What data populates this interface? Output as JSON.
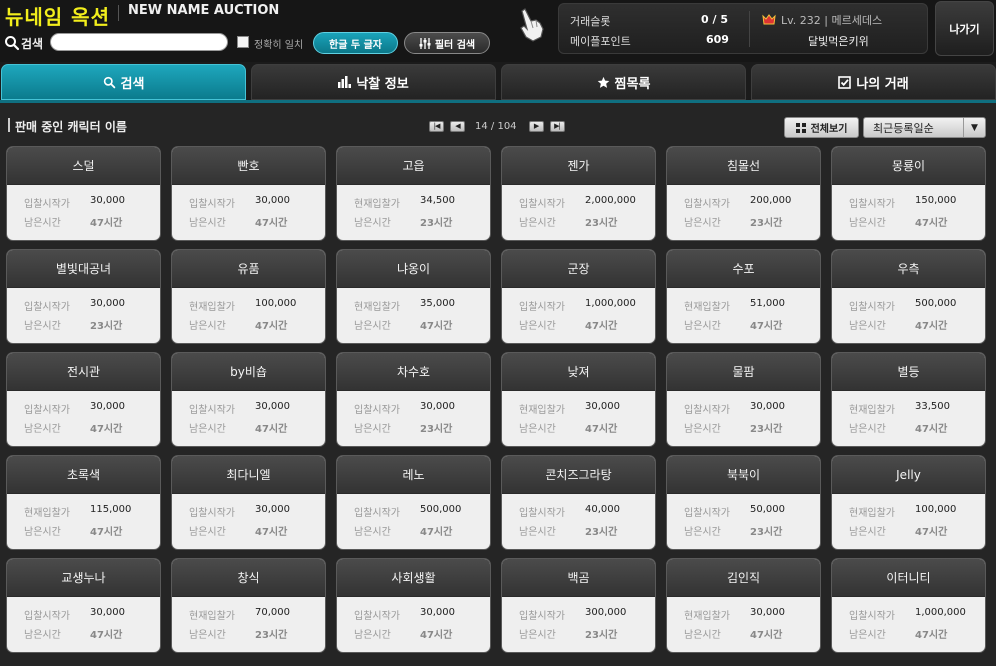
{
  "header": {
    "title_ko": "뉴네임 옥션",
    "title_en": "NEW NAME AUCTION",
    "search_label": "검색",
    "search_value": "",
    "exact_match_label": "정확히 일치",
    "two_letter_button": "한글 두 글자",
    "filter_button": "필터 검색",
    "exit_button": "나가기"
  },
  "info": {
    "slot_label": "거래슬롯",
    "slot_value": "0 / 5",
    "points_label": "메이플포인트",
    "points_value": "609",
    "level_text": "Lv. 232 | 메르세데스",
    "character_name": "달빛먹은키위"
  },
  "tabs": [
    {
      "label": "검색",
      "icon": "search-icon",
      "active": true
    },
    {
      "label": "낙찰 정보",
      "icon": "bar-chart-icon",
      "active": false
    },
    {
      "label": "찜목록",
      "icon": "star-icon",
      "active": false
    },
    {
      "label": "나의 거래",
      "icon": "checkbox-icon",
      "active": false
    }
  ],
  "list": {
    "title": "판매 중인 캐릭터 이름",
    "page_text": "14 / 104",
    "view_all_label": "전체보기",
    "sort_value": "최근등록일순"
  },
  "colors": {
    "accent": "#1597ad",
    "title_yellow": "#f2ee1c"
  },
  "cards": [
    {
      "name": "스덜",
      "price_label": "입찰시작가",
      "price": "30,000",
      "time_label": "남은시간",
      "time": "47시간"
    },
    {
      "name": "빤호",
      "price_label": "입찰시작가",
      "price": "30,000",
      "time_label": "남은시간",
      "time": "47시간"
    },
    {
      "name": "고읍",
      "price_label": "현재입찰가",
      "price": "34,500",
      "time_label": "남은시간",
      "time": "23시간"
    },
    {
      "name": "젠가",
      "price_label": "입찰시작가",
      "price": "2,000,000",
      "time_label": "남은시간",
      "time": "23시간"
    },
    {
      "name": "침몰선",
      "price_label": "입찰시작가",
      "price": "200,000",
      "time_label": "남은시간",
      "time": "23시간"
    },
    {
      "name": "몽룡이",
      "price_label": "입찰시작가",
      "price": "150,000",
      "time_label": "남은시간",
      "time": "47시간"
    },
    {
      "name": "별빛대공녀",
      "price_label": "입찰시작가",
      "price": "30,000",
      "time_label": "남은시간",
      "time": "23시간"
    },
    {
      "name": "유품",
      "price_label": "현재입찰가",
      "price": "100,000",
      "time_label": "남은시간",
      "time": "47시간"
    },
    {
      "name": "냐옹이",
      "price_label": "현재입찰가",
      "price": "35,000",
      "time_label": "남은시간",
      "time": "47시간"
    },
    {
      "name": "군장",
      "price_label": "입찰시작가",
      "price": "1,000,000",
      "time_label": "남은시간",
      "time": "47시간"
    },
    {
      "name": "수포",
      "price_label": "현재입찰가",
      "price": "51,000",
      "time_label": "남은시간",
      "time": "47시간"
    },
    {
      "name": "우측",
      "price_label": "입찰시작가",
      "price": "500,000",
      "time_label": "남은시간",
      "time": "47시간"
    },
    {
      "name": "전시관",
      "price_label": "입찰시작가",
      "price": "30,000",
      "time_label": "남은시간",
      "time": "47시간"
    },
    {
      "name": "by비숍",
      "price_label": "입찰시작가",
      "price": "30,000",
      "time_label": "남은시간",
      "time": "47시간"
    },
    {
      "name": "차수호",
      "price_label": "입찰시작가",
      "price": "30,000",
      "time_label": "남은시간",
      "time": "23시간"
    },
    {
      "name": "낮져",
      "price_label": "현재입찰가",
      "price": "30,000",
      "time_label": "남은시간",
      "time": "47시간"
    },
    {
      "name": "물팜",
      "price_label": "입찰시작가",
      "price": "30,000",
      "time_label": "남은시간",
      "time": "23시간"
    },
    {
      "name": "별등",
      "price_label": "현재입찰가",
      "price": "33,500",
      "time_label": "남은시간",
      "time": "47시간"
    },
    {
      "name": "초록색",
      "price_label": "현재입찰가",
      "price": "115,000",
      "time_label": "남은시간",
      "time": "47시간"
    },
    {
      "name": "최다니엘",
      "price_label": "입찰시작가",
      "price": "30,000",
      "time_label": "남은시간",
      "time": "47시간"
    },
    {
      "name": "레노",
      "price_label": "입찰시작가",
      "price": "500,000",
      "time_label": "남은시간",
      "time": "47시간"
    },
    {
      "name": "콘치즈그라탕",
      "price_label": "입찰시작가",
      "price": "40,000",
      "time_label": "남은시간",
      "time": "23시간"
    },
    {
      "name": "북북이",
      "price_label": "입찰시작가",
      "price": "50,000",
      "time_label": "남은시간",
      "time": "23시간"
    },
    {
      "name": "Jelly",
      "price_label": "현재입찰가",
      "price": "100,000",
      "time_label": "남은시간",
      "time": "47시간"
    },
    {
      "name": "교생누나",
      "price_label": "입찰시작가",
      "price": "30,000",
      "time_label": "남은시간",
      "time": "47시간"
    },
    {
      "name": "창식",
      "price_label": "현재입찰가",
      "price": "70,000",
      "time_label": "남은시간",
      "time": "23시간"
    },
    {
      "name": "사회생활",
      "price_label": "입찰시작가",
      "price": "30,000",
      "time_label": "남은시간",
      "time": "47시간"
    },
    {
      "name": "백곰",
      "price_label": "입찰시작가",
      "price": "300,000",
      "time_label": "남은시간",
      "time": "23시간"
    },
    {
      "name": "김인직",
      "price_label": "현재입찰가",
      "price": "30,000",
      "time_label": "남은시간",
      "time": "47시간"
    },
    {
      "name": "이터니티",
      "price_label": "입찰시작가",
      "price": "1,000,000",
      "time_label": "남은시간",
      "time": "47시간"
    }
  ]
}
